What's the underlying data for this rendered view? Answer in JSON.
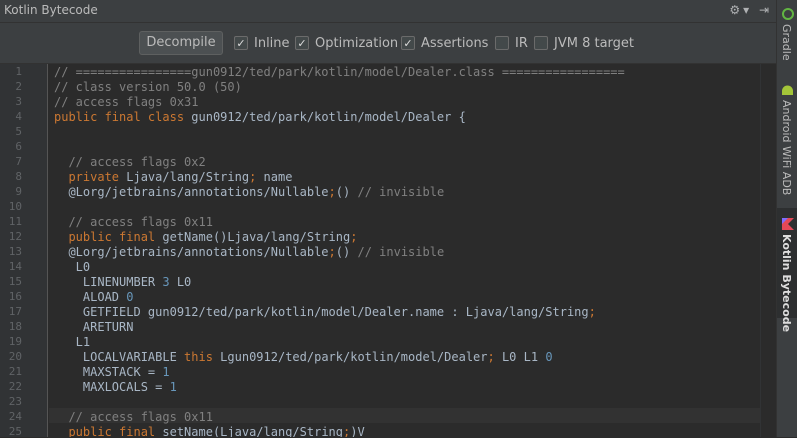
{
  "window": {
    "title": "Kotlin Bytecode"
  },
  "toolbar": {
    "decompile_label": "Decompile",
    "options": [
      {
        "label": "Inline",
        "checked": true
      },
      {
        "label": "Optimization",
        "checked": true
      },
      {
        "label": "Assertions",
        "checked": true
      },
      {
        "label": "IR",
        "checked": false
      },
      {
        "label": "JVM 8 target",
        "checked": false
      }
    ]
  },
  "editor": {
    "line_numbers": [
      "1",
      "2",
      "3",
      "4",
      "5",
      "6",
      "7",
      "8",
      "9",
      "10",
      "11",
      "12",
      "13",
      "14",
      "15",
      "16",
      "17",
      "18",
      "19",
      "20",
      "21",
      "22",
      "23",
      "24",
      "25"
    ],
    "lines": [
      [
        {
          "t": "// ================gun0912/ted/park/kotlin/model/Dealer.class =================",
          "c": "cm"
        }
      ],
      [
        {
          "t": "// class version 50.0 (50)",
          "c": "cm"
        }
      ],
      [
        {
          "t": "// access flags 0x31",
          "c": "cm"
        }
      ],
      [
        {
          "t": "public final class ",
          "c": "kw"
        },
        {
          "t": "gun0912/ted/park/kotlin/model/Dealer {",
          "c": ""
        }
      ],
      [],
      [],
      [
        {
          "t": "  // access flags 0x2",
          "c": "cm"
        }
      ],
      [
        {
          "t": "  private ",
          "c": "kw"
        },
        {
          "t": "Ljava/lang/String",
          "c": ""
        },
        {
          "t": ";",
          "c": "kw"
        },
        {
          "t": " name",
          "c": ""
        }
      ],
      [
        {
          "t": "  @Lorg/jetbrains/annotations/Nullable",
          "c": ""
        },
        {
          "t": ";",
          "c": "kw"
        },
        {
          "t": "() ",
          "c": ""
        },
        {
          "t": "// invisible",
          "c": "cm"
        }
      ],
      [],
      [
        {
          "t": "  // access flags 0x11",
          "c": "cm"
        }
      ],
      [
        {
          "t": "  public final ",
          "c": "kw"
        },
        {
          "t": "getName()Ljava/lang/String",
          "c": ""
        },
        {
          "t": ";",
          "c": "kw"
        }
      ],
      [
        {
          "t": "  @Lorg/jetbrains/annotations/Nullable",
          "c": ""
        },
        {
          "t": ";",
          "c": "kw"
        },
        {
          "t": "() ",
          "c": ""
        },
        {
          "t": "// invisible",
          "c": "cm"
        }
      ],
      [
        {
          "t": "   L0",
          "c": ""
        }
      ],
      [
        {
          "t": "    LINENUMBER ",
          "c": ""
        },
        {
          "t": "3",
          "c": "nm"
        },
        {
          "t": " L0",
          "c": ""
        }
      ],
      [
        {
          "t": "    ALOAD ",
          "c": ""
        },
        {
          "t": "0",
          "c": "nm"
        }
      ],
      [
        {
          "t": "    GETFIELD gun0912/ted/park/kotlin/model/Dealer.name : Ljava/lang/String",
          "c": ""
        },
        {
          "t": ";",
          "c": "kw"
        }
      ],
      [
        {
          "t": "    ARETURN",
          "c": ""
        }
      ],
      [
        {
          "t": "   L1",
          "c": ""
        }
      ],
      [
        {
          "t": "    LOCALVARIABLE ",
          "c": ""
        },
        {
          "t": "this",
          "c": "kw"
        },
        {
          "t": " Lgun0912/ted/park/kotlin/model/Dealer",
          "c": ""
        },
        {
          "t": ";",
          "c": "kw"
        },
        {
          "t": " L0 L1 ",
          "c": ""
        },
        {
          "t": "0",
          "c": "nm"
        }
      ],
      [
        {
          "t": "    MAXSTACK = ",
          "c": ""
        },
        {
          "t": "1",
          "c": "nm"
        }
      ],
      [
        {
          "t": "    MAXLOCALS = ",
          "c": ""
        },
        {
          "t": "1",
          "c": "nm"
        }
      ],
      [],
      [
        {
          "t": "  // access flags 0x11",
          "c": "cm"
        }
      ],
      [
        {
          "t": "  public final ",
          "c": "kw"
        },
        {
          "t": "setName(Ljava/lang/String",
          "c": ""
        },
        {
          "t": ";",
          "c": "kw"
        },
        {
          "t": ")V",
          "c": ""
        }
      ]
    ]
  },
  "sidebar": {
    "tabs": [
      {
        "label": "Gradle",
        "icon": "gradle-icon"
      },
      {
        "label": "Android WiFi ADB",
        "icon": "android-icon"
      },
      {
        "label": "Kotlin Bytecode",
        "icon": "kotlin-icon",
        "active": true
      }
    ]
  },
  "colors": {
    "keyword": "#cc7832",
    "comment": "#808080",
    "number": "#6897bb",
    "text": "#a9b7c6",
    "background": "#2b2b2b"
  }
}
